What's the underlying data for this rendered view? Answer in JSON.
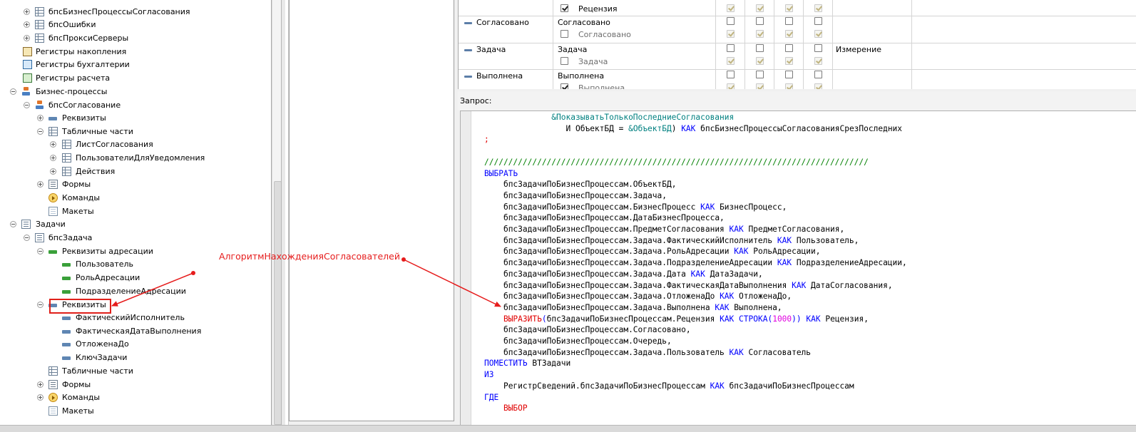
{
  "tree": {
    "items": [
      {
        "label": "бпсБизнесПроцессыСогласования",
        "icon": "table-icon",
        "expander": "plus"
      },
      {
        "label": "бпсОшибки",
        "icon": "table-icon",
        "expander": "plus"
      },
      {
        "label": "бпсПроксиСерверы",
        "icon": "table-icon",
        "expander": "plus"
      },
      {
        "label": "Регистры накопления",
        "icon": "accumulation-register-icon",
        "expander": "none"
      },
      {
        "label": "Регистры бухгалтерии",
        "icon": "accounting-register-icon",
        "expander": "none"
      },
      {
        "label": "Регистры расчета",
        "icon": "calculation-register-icon",
        "expander": "none"
      },
      {
        "label": "Бизнес-процессы",
        "icon": "business-process-icon",
        "expander": "minus"
      },
      {
        "label": "бпсСогласование",
        "icon": "business-process-icon",
        "expander": "minus"
      },
      {
        "label": "Реквизиты",
        "icon": "attribute-icon",
        "expander": "plus"
      },
      {
        "label": "Табличные части",
        "icon": "table-icon",
        "expander": "minus"
      },
      {
        "label": "ЛистСогласования",
        "icon": "table-icon",
        "expander": "plus"
      },
      {
        "label": "ПользователиДляУведомления",
        "icon": "table-icon",
        "expander": "plus"
      },
      {
        "label": "Действия",
        "icon": "table-icon",
        "expander": "plus"
      },
      {
        "label": "Формы",
        "icon": "form-icon",
        "expander": "plus"
      },
      {
        "label": "Команды",
        "icon": "command-icon",
        "expander": "none"
      },
      {
        "label": "Макеты",
        "icon": "layout-icon",
        "expander": "none"
      },
      {
        "label": "Задачи",
        "icon": "task-icon",
        "expander": "minus"
      },
      {
        "label": "бпсЗадача",
        "icon": "task-icon",
        "expander": "minus"
      },
      {
        "label": "Реквизиты адресации",
        "icon": "addressing-attribute-icon",
        "expander": "minus"
      },
      {
        "label": "Пользователь",
        "icon": "addressing-attribute-icon",
        "expander": "none"
      },
      {
        "label": "РольАдресации",
        "icon": "addressing-attribute-icon",
        "expander": "none"
      },
      {
        "label": "ПодразделениеАдресации",
        "icon": "addressing-attribute-icon",
        "expander": "none"
      },
      {
        "label": "Реквизиты",
        "icon": "attribute-icon",
        "expander": "minus"
      },
      {
        "label": "ФактическийИсполнитель",
        "icon": "attribute-icon",
        "expander": "none"
      },
      {
        "label": "ФактическаяДатаВыполнения",
        "icon": "attribute-icon",
        "expander": "none"
      },
      {
        "label": "ОтложенаДо",
        "icon": "attribute-icon",
        "expander": "none"
      },
      {
        "label": "КлючЗадачи",
        "icon": "attribute-icon",
        "expander": "none"
      },
      {
        "label": "Табличные части",
        "icon": "table-icon",
        "expander": "none"
      },
      {
        "label": "Формы",
        "icon": "form-icon",
        "expander": "plus"
      },
      {
        "label": "Команды",
        "icon": "command-icon",
        "expander": "plus"
      },
      {
        "label": "Макеты",
        "icon": "layout-icon",
        "expander": "none"
      }
    ]
  },
  "grid": {
    "rows": [
      {
        "name": "",
        "field": "Рецензия",
        "field_checked": true,
        "type": ""
      },
      {
        "name": "Согласовано",
        "field": "Согласовано",
        "subfield": "Согласовано",
        "type": ""
      },
      {
        "name": "Задача",
        "field": "Задача",
        "subfield": "Задача",
        "type": "Измерение"
      },
      {
        "name": "Выполнена",
        "field": "Выполнена",
        "subfield": "Выполнена",
        "type": ""
      }
    ]
  },
  "query": {
    "label": "Запрос:",
    "lines": [
      {
        "indent": "              ",
        "parts": [
          {
            "c": "pm",
            "t": "&ПоказыватьТолькоПоследниеСогласования"
          }
        ]
      },
      {
        "indent": "                 ",
        "parts": [
          {
            "c": "",
            "t": "И ОбъектБД = "
          },
          {
            "c": "pm",
            "t": "&ОбъектБД"
          },
          {
            "c": "",
            "t": ") "
          },
          {
            "c": "kw",
            "t": "КАК"
          },
          {
            "c": "",
            "t": " бпсБизнесПроцессыСогласованияСрезПоследних"
          }
        ]
      },
      {
        "indent": "",
        "parts": [
          {
            "c": "fn",
            "t": ";"
          }
        ]
      },
      {
        "indent": "",
        "parts": []
      },
      {
        "indent": "",
        "parts": [
          {
            "c": "cm",
            "t": "////////////////////////////////////////////////////////////////////////////////"
          }
        ]
      },
      {
        "indent": "",
        "parts": [
          {
            "c": "kw",
            "t": "ВЫБРАТЬ"
          }
        ]
      },
      {
        "indent": "    ",
        "parts": [
          {
            "c": "",
            "t": "бпсЗадачиПоБизнесПроцессам.ОбъектБД,"
          }
        ]
      },
      {
        "indent": "    ",
        "parts": [
          {
            "c": "",
            "t": "бпсЗадачиПоБизнесПроцессам.Задача,"
          }
        ]
      },
      {
        "indent": "    ",
        "parts": [
          {
            "c": "",
            "t": "бпсЗадачиПоБизнесПроцессам.БизнесПроцесс "
          },
          {
            "c": "kw",
            "t": "КАК"
          },
          {
            "c": "",
            "t": " БизнесПроцесс,"
          }
        ]
      },
      {
        "indent": "    ",
        "parts": [
          {
            "c": "",
            "t": "бпсЗадачиПоБизнесПроцессам.ДатаБизнесПроцесса,"
          }
        ]
      },
      {
        "indent": "    ",
        "parts": [
          {
            "c": "",
            "t": "бпсЗадачиПоБизнесПроцессам.ПредметСогласования "
          },
          {
            "c": "kw",
            "t": "КАК"
          },
          {
            "c": "",
            "t": " ПредметСогласования,"
          }
        ]
      },
      {
        "indent": "    ",
        "parts": [
          {
            "c": "",
            "t": "бпсЗадачиПоБизнесПроцессам.Задача.ФактическийИсполнитель "
          },
          {
            "c": "kw",
            "t": "КАК"
          },
          {
            "c": "",
            "t": " Пользователь,"
          }
        ]
      },
      {
        "indent": "    ",
        "parts": [
          {
            "c": "",
            "t": "бпсЗадачиПоБизнесПроцессам.Задача.РольАдресации "
          },
          {
            "c": "kw",
            "t": "КАК"
          },
          {
            "c": "",
            "t": " РольАдресации,"
          }
        ]
      },
      {
        "indent": "    ",
        "parts": [
          {
            "c": "",
            "t": "бпсЗадачиПоБизнесПроцессам.Задача.ПодразделениеАдресации "
          },
          {
            "c": "kw",
            "t": "КАК"
          },
          {
            "c": "",
            "t": " ПодразделениеАдресации,"
          }
        ]
      },
      {
        "indent": "    ",
        "parts": [
          {
            "c": "",
            "t": "бпсЗадачиПоБизнесПроцессам.Задача.Дата "
          },
          {
            "c": "kw",
            "t": "КАК"
          },
          {
            "c": "",
            "t": " ДатаЗадачи,"
          }
        ]
      },
      {
        "indent": "    ",
        "parts": [
          {
            "c": "",
            "t": "бпсЗадачиПоБизнесПроцессам.Задача.ФактическаяДатаВыполнения "
          },
          {
            "c": "kw",
            "t": "КАК"
          },
          {
            "c": "",
            "t": " ДатаСогласования,"
          }
        ]
      },
      {
        "indent": "    ",
        "parts": [
          {
            "c": "",
            "t": "бпсЗадачиПоБизнесПроцессам.Задача.ОтложенаДо "
          },
          {
            "c": "kw",
            "t": "КАК"
          },
          {
            "c": "",
            "t": " ОтложенаДо,"
          }
        ]
      },
      {
        "indent": "    ",
        "parts": [
          {
            "c": "",
            "t": "бпсЗадачиПоБизнесПроцессам.Задача.Выполнена "
          },
          {
            "c": "kw",
            "t": "КАК"
          },
          {
            "c": "",
            "t": " Выполнена,"
          }
        ]
      },
      {
        "indent": "    ",
        "parts": [
          {
            "c": "fn",
            "t": "ВЫРАЗИТЬ"
          },
          {
            "c": "kw",
            "t": "("
          },
          {
            "c": "",
            "t": "бпсЗадачиПоБизнесПроцессам.Рецензия "
          },
          {
            "c": "kw",
            "t": "КАК"
          },
          {
            "c": "",
            "t": " "
          },
          {
            "c": "kw",
            "t": "СТРОКА("
          },
          {
            "c": "nm",
            "t": "1000"
          },
          {
            "c": "kw",
            "t": "))"
          },
          {
            "c": "",
            "t": " "
          },
          {
            "c": "kw",
            "t": "КАК"
          },
          {
            "c": "",
            "t": " Рецензия,"
          }
        ]
      },
      {
        "indent": "    ",
        "parts": [
          {
            "c": "",
            "t": "бпсЗадачиПоБизнесПроцессам.Согласовано,"
          }
        ]
      },
      {
        "indent": "    ",
        "parts": [
          {
            "c": "",
            "t": "бпсЗадачиПоБизнесПроцессам.Очередь,"
          }
        ]
      },
      {
        "indent": "    ",
        "parts": [
          {
            "c": "",
            "t": "бпсЗадачиПоБизнесПроцессам.Задача.Пользователь "
          },
          {
            "c": "kw",
            "t": "КАК"
          },
          {
            "c": "",
            "t": " Согласователь"
          }
        ]
      },
      {
        "indent": "",
        "parts": [
          {
            "c": "kw",
            "t": "ПОМЕСТИТЬ"
          },
          {
            "c": "",
            "t": " ВТЗадачи"
          }
        ]
      },
      {
        "indent": "",
        "parts": [
          {
            "c": "kw",
            "t": "ИЗ"
          }
        ]
      },
      {
        "indent": "    ",
        "parts": [
          {
            "c": "",
            "t": "РегистрСведений.бпсЗадачиПоБизнесПроцессам "
          },
          {
            "c": "kw",
            "t": "КАК"
          },
          {
            "c": "",
            "t": " бпсЗадачиПоБизнесПроцессам"
          }
        ]
      },
      {
        "indent": "",
        "parts": [
          {
            "c": "kw",
            "t": "ГДЕ"
          }
        ]
      },
      {
        "indent": "    ",
        "parts": [
          {
            "c": "fn",
            "t": "ВЫБОР"
          }
        ]
      }
    ]
  },
  "annotation": {
    "text": "АлгоритмНахожденияСогласователей",
    "color": "#e61c1c"
  }
}
